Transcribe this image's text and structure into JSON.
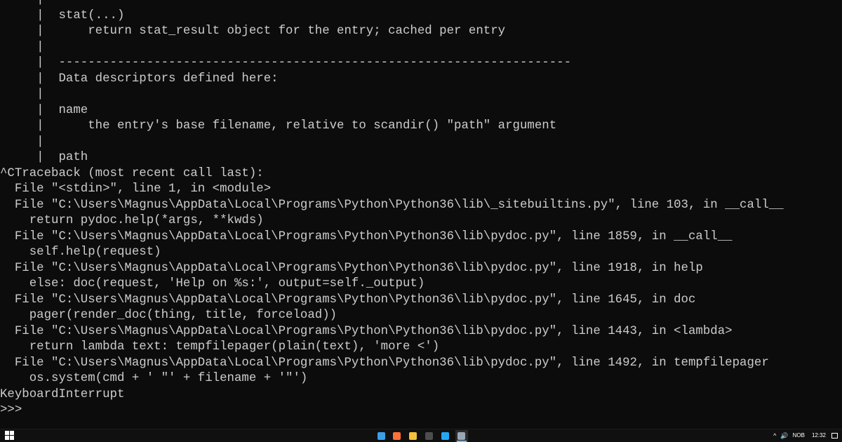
{
  "console": {
    "lines": [
      "     |",
      "     |  stat(...)",
      "     |      return stat_result object for the entry; cached per entry",
      "     |",
      "     |  ----------------------------------------------------------------------",
      "     |  Data descriptors defined here:",
      "     |",
      "     |  name",
      "     |      the entry's base filename, relative to scandir() \"path\" argument",
      "     |",
      "     |  path",
      "^CTraceback (most recent call last):",
      "  File \"<stdin>\", line 1, in <module>",
      "  File \"C:\\Users\\Magnus\\AppData\\Local\\Programs\\Python\\Python36\\lib\\_sitebuiltins.py\", line 103, in __call__",
      "    return pydoc.help(*args, **kwds)",
      "  File \"C:\\Users\\Magnus\\AppData\\Local\\Programs\\Python\\Python36\\lib\\pydoc.py\", line 1859, in __call__",
      "    self.help(request)",
      "  File \"C:\\Users\\Magnus\\AppData\\Local\\Programs\\Python\\Python36\\lib\\pydoc.py\", line 1918, in help",
      "    else: doc(request, 'Help on %s:', output=self._output)",
      "  File \"C:\\Users\\Magnus\\AppData\\Local\\Programs\\Python\\Python36\\lib\\pydoc.py\", line 1645, in doc",
      "    pager(render_doc(thing, title, forceload))",
      "  File \"C:\\Users\\Magnus\\AppData\\Local\\Programs\\Python\\Python36\\lib\\pydoc.py\", line 1443, in <lambda>",
      "    return lambda text: tempfilepager(plain(text), 'more <')",
      "  File \"C:\\Users\\Magnus\\AppData\\Local\\Programs\\Python\\Python36\\lib\\pydoc.py\", line 1492, in tempfilepager",
      "    os.system(cmd + ' \"' + filename + '\"')",
      "KeyboardInterrupt",
      ">>>"
    ]
  },
  "taskbar": {
    "apps": [
      {
        "name": "edge-app-icon",
        "color": "#3aa0e8",
        "active": false
      },
      {
        "name": "firefox-app-icon",
        "color": "#ff7139",
        "active": false
      },
      {
        "name": "file-explorer-app-icon",
        "color": "#f3c13a",
        "active": false
      },
      {
        "name": "command-prompt-app-icon",
        "color": "#4d4d4d",
        "active": false
      },
      {
        "name": "vscode-app-icon",
        "color": "#23a9f2",
        "active": false
      },
      {
        "name": "python-app-icon",
        "color": "#9aa6b2",
        "active": true
      }
    ],
    "tray": {
      "expand_glyph": "^",
      "volume_glyph": "🔊",
      "language": "NOB",
      "time": "12:32"
    },
    "accent_color": "#76b9ed"
  },
  "colors": {
    "console_background": "#0c0c0c",
    "console_text": "#cccccc",
    "taskbar_background": "#101010"
  }
}
